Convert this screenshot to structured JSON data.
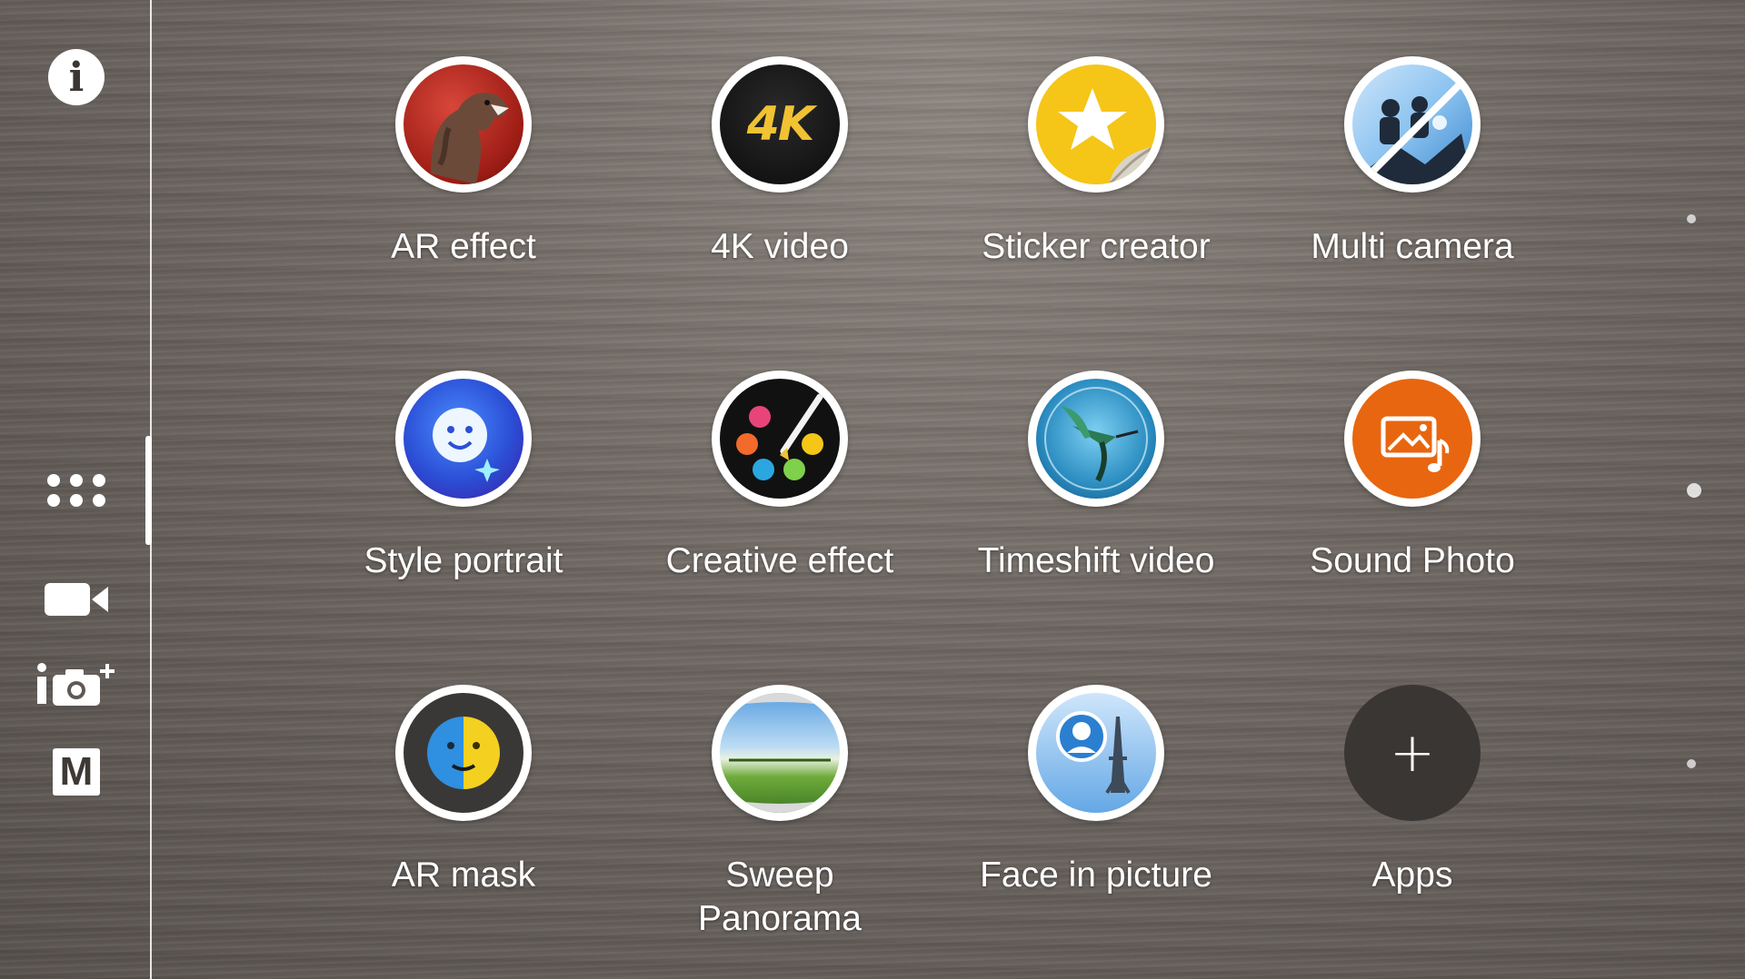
{
  "rail": {
    "info_icon": "info-icon",
    "info_glyph": "i",
    "apps_grid_icon": "apps-grid-icon",
    "video_icon": "video-camera-icon",
    "superior_auto_icon": "superior-auto-camera-icon",
    "manual_label": "M"
  },
  "modes": [
    {
      "label": "AR effect",
      "icon": "ar-effect-dinosaur-icon"
    },
    {
      "label": "4K video",
      "icon": "4k-video-icon",
      "badge_text": "4K"
    },
    {
      "label": "Sticker creator",
      "icon": "sticker-creator-star-icon"
    },
    {
      "label": "Multi camera",
      "icon": "multi-camera-icon"
    },
    {
      "label": "Style portrait",
      "icon": "style-portrait-face-icon"
    },
    {
      "label": "Creative effect",
      "icon": "creative-effect-palette-icon"
    },
    {
      "label": "Timeshift video",
      "icon": "timeshift-video-hummingbird-icon"
    },
    {
      "label": "Sound Photo",
      "icon": "sound-photo-icon"
    },
    {
      "label": "AR mask",
      "icon": "ar-mask-face-icon"
    },
    {
      "label": "Sweep Panorama",
      "icon": "sweep-panorama-icon"
    },
    {
      "label": "Face in picture",
      "icon": "face-in-picture-icon"
    },
    {
      "label": "Apps",
      "icon": "plus-icon",
      "badge_text": "+"
    }
  ],
  "colors": {
    "accent_white": "#ffffff",
    "sound_photo_orange": "#e8660f",
    "sticker_yellow": "#f5c518",
    "style_portrait_blue": "#2f6ff0",
    "ar_mask_blue": "#2f8fe0",
    "ar_mask_yellow": "#f4d020"
  }
}
